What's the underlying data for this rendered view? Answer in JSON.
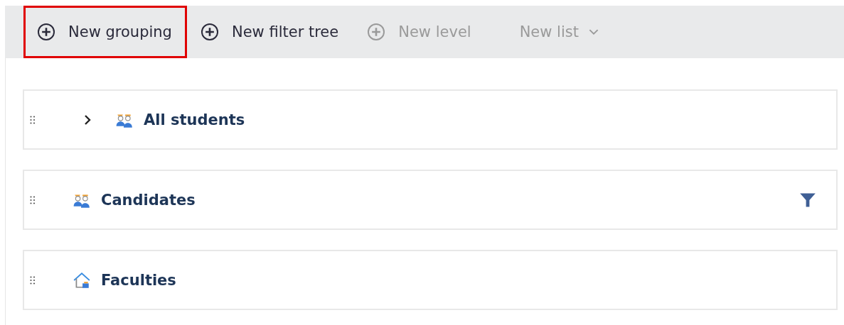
{
  "toolbar": [
    {
      "label": "New grouping",
      "kind": "button",
      "disabled": false,
      "highlighted": true
    },
    {
      "label": "New filter tree",
      "kind": "button",
      "disabled": false,
      "highlighted": false
    },
    {
      "label": "New level",
      "kind": "button",
      "disabled": true,
      "highlighted": false
    },
    {
      "label": "New list",
      "kind": "dropdown",
      "disabled": true,
      "highlighted": false
    }
  ],
  "rows": [
    {
      "label": "All students",
      "kind": "people",
      "expandable": true,
      "expanded": false,
      "filtered": false
    },
    {
      "label": "Candidates",
      "kind": "people",
      "expandable": false,
      "filtered": true
    },
    {
      "label": "Faculties",
      "kind": "house",
      "expandable": false,
      "filtered": false
    }
  ]
}
